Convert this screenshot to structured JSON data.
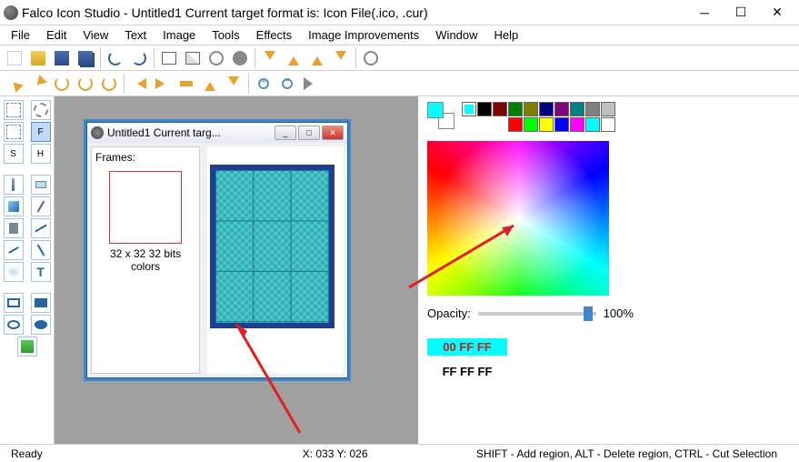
{
  "title": "Falco Icon Studio - Untitled1  Current target format is: Icon File(.ico, .cur)",
  "menu": [
    "File",
    "Edit",
    "View",
    "Text",
    "Image",
    "Tools",
    "Effects",
    "Image Improvements",
    "Window",
    "Help"
  ],
  "doc": {
    "title": "Untitled1  Current targ...",
    "frames_label": "Frames:",
    "frame_info": "32 x 32 32 bits colors"
  },
  "palette_colors_row1": [
    "#00ffff",
    "#000000",
    "#800000",
    "#008000",
    "#808000",
    "#000080",
    "#800080",
    "#008080",
    "#808080",
    "#c0c0c0"
  ],
  "palette_colors_row2": [
    "#ff0000",
    "#00ff00",
    "#ffff00",
    "#0000ff",
    "#ff00ff",
    "#00ffff",
    "#ffffff"
  ],
  "opacity": {
    "label": "Opacity:",
    "value": "100%"
  },
  "color_fg_hex": "00 FF FF",
  "color_bg_hex": "FF FF FF",
  "status": {
    "ready": "Ready",
    "coords": "X: 033 Y: 026",
    "hint": "SHIFT - Add region, ALT - Delete region, CTRL - Cut Selection"
  }
}
